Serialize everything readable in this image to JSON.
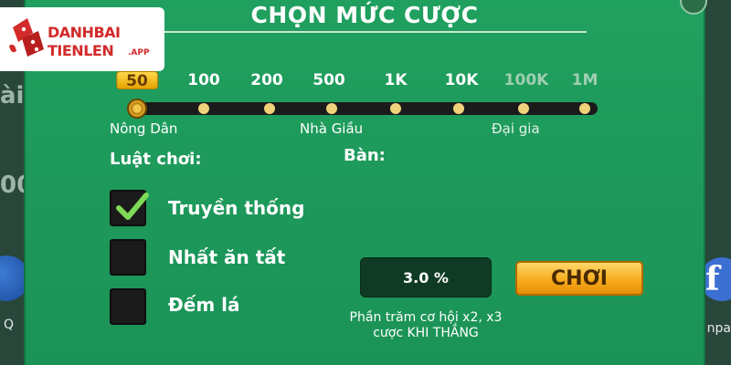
{
  "background": {
    "left_text_1": "ài",
    "left_text_2": "00",
    "left_bottom_label": "Q",
    "right_bottom_label": "npa",
    "right_icon_letter": "f"
  },
  "logo": {
    "line1": "DANHBAI",
    "line2": "TIENLEN",
    "suffix": ".APP"
  },
  "dialog": {
    "title": "CHỌN MỨC CƯỢC",
    "bet_levels": [
      {
        "label": "50",
        "state": "selected"
      },
      {
        "label": "100",
        "state": "enabled"
      },
      {
        "label": "200",
        "state": "enabled"
      },
      {
        "label": "500",
        "state": "enabled"
      },
      {
        "label": "1K",
        "state": "enabled"
      },
      {
        "label": "10K",
        "state": "enabled"
      },
      {
        "label": "100K",
        "state": "disabled"
      },
      {
        "label": "1M",
        "state": "disabled"
      }
    ],
    "tiers": [
      "Nông Dân",
      "Nhà Giầu",
      "Đại gia"
    ],
    "rules_label": "Luật chơi:",
    "table_label": "Bàn:",
    "options": [
      {
        "label": "Truyền thống",
        "checked": true
      },
      {
        "label": "Nhất ăn tất",
        "checked": false
      },
      {
        "label": "Đếm lá",
        "checked": false
      }
    ],
    "percent_value": "3.0 %",
    "percent_caption_1": "Phần trăm cơ hội x2, x3",
    "percent_caption_2": "cược KHI THẮNG",
    "play_label": "CHƠI"
  },
  "colors": {
    "dialog_green": "#1e9a5c",
    "accent_gold": "#f6a817",
    "check_green": "#7ed957"
  }
}
